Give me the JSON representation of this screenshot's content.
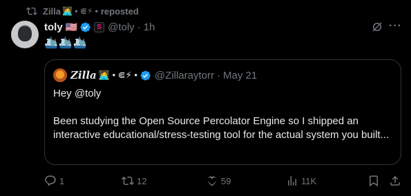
{
  "repost": {
    "icon": "repost-icon",
    "name": "Zilla",
    "emoji": "🧑‍💻 • ⋐⚡ •",
    "label": "reposted"
  },
  "tweet": {
    "avatar": "toly-avatar",
    "name": "toly",
    "flag": "🇺🇸",
    "handle": "@toly",
    "dot": "·",
    "time": "1h",
    "emoji_line": "🛳️🛳️🛳️"
  },
  "quote": {
    "name": "Zilla",
    "badges": "🧑‍💻 • ⋐⚡ •",
    "handle": "@Zillaraytorr",
    "dot": "·",
    "date": "May 21",
    "body": [
      "Hey @toly",
      "Been studying the Open Source Percolator Engine so I shipped an interactive educational/stress-testing tool for the actual system you built..."
    ]
  },
  "actions": {
    "reply_count": "1",
    "repost_count": "12",
    "like_count": "59",
    "view_count": "11K"
  },
  "colors": {
    "background": "#000000",
    "text": "#e7e9ea",
    "muted": "#71767b",
    "verified": "#1d9bf0",
    "border": "#2f3336"
  }
}
